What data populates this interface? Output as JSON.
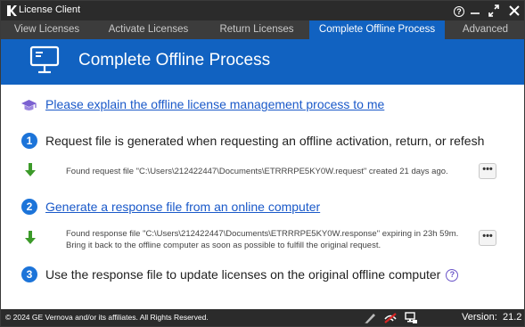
{
  "window": {
    "title": "License Client",
    "help_label": "?",
    "minimize_label": "—",
    "maximize_label": "⤢",
    "close_label": "✕"
  },
  "tabs": [
    {
      "label": "View Licenses",
      "active": false
    },
    {
      "label": "Activate Licenses",
      "active": false
    },
    {
      "label": "Return Licenses",
      "active": false
    },
    {
      "label": "Complete Offline Process",
      "active": true
    },
    {
      "label": "Advanced",
      "active": false
    }
  ],
  "header": {
    "title": "Complete Offline Process",
    "icon": "monitor-icon"
  },
  "content": {
    "explain_link": "Please explain the offline license management process to me",
    "step1": {
      "number": "1",
      "text": "Request file is generated when requesting an offline activation, return, or refesh",
      "status": "Found request file \"C:\\Users\\212422447\\Documents\\ETRRRPE5KY0W.request\" created 21 days ago.",
      "more_label": "•••"
    },
    "step2": {
      "number": "2",
      "link": "Generate a response file from an online computer",
      "status_line1": "Found response file \"C:\\Users\\212422447\\Documents\\ETRRRPE5KY0W.response\" expiring in 23h 59m.",
      "status_line2": "Bring it back to the offline computer as soon as possible to fulfill the original request.",
      "more_label": "•••"
    },
    "step3": {
      "number": "3",
      "text": "Use the response file to update licenses on the original offline computer",
      "help_label": "?"
    }
  },
  "footer": {
    "copyright": "© 2024 GE Vernova and/or its affiliates.  All Rights Reserved.",
    "version_label": "Version:",
    "version_value": "21.2"
  },
  "colors": {
    "accent": "#1162c1",
    "link": "#1a59c9",
    "green_arrow": "#3c9a2a",
    "titlebar": "#2b2b2b"
  }
}
